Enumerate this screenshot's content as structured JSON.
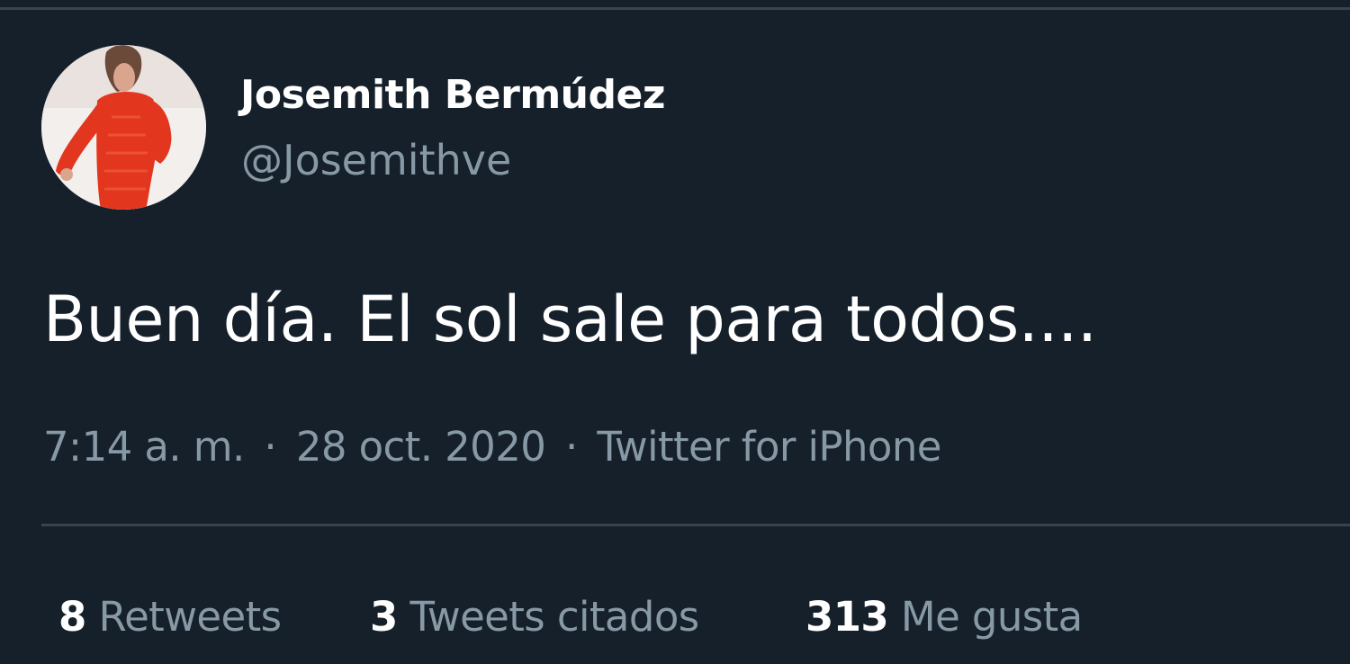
{
  "tweet": {
    "author": {
      "display_name": "Josemith Bermúdez",
      "handle": "@Josemithve"
    },
    "text": "Buen día. El sol sale para todos....",
    "time": "7:14 a. m.",
    "separator": "·",
    "date": "28 oct. 2020",
    "source": "Twitter for iPhone"
  },
  "stats": {
    "retweets": {
      "count": "8",
      "label": "Retweets"
    },
    "quotes": {
      "count": "3",
      "label": "Tweets citados"
    },
    "likes": {
      "count": "313",
      "label": "Me gusta"
    }
  },
  "colors": {
    "background": "#15202b",
    "border": "#38444d",
    "primary_text": "#ffffff",
    "secondary_text": "#8899a6"
  }
}
